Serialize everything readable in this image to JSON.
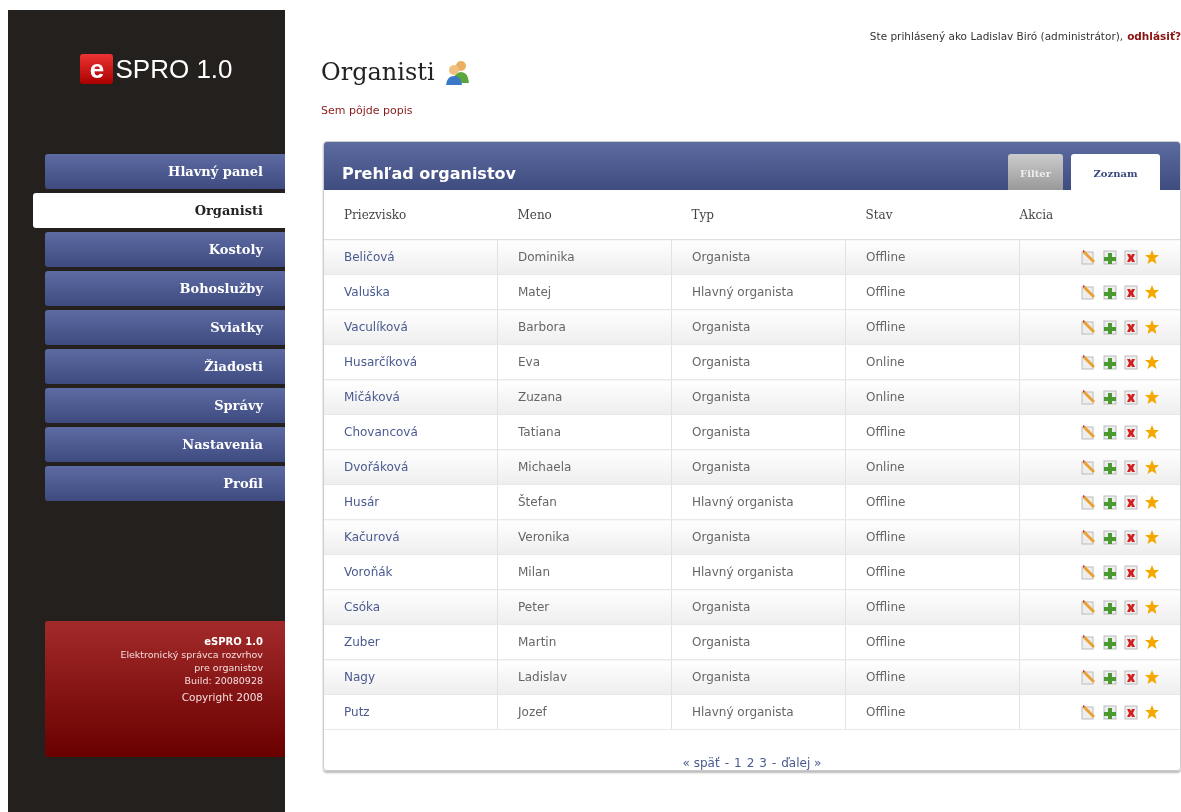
{
  "logo": {
    "mark": "e",
    "name": "SPRO 1.0"
  },
  "menu": [
    {
      "label": "Hlavný panel",
      "selected": false
    },
    {
      "label": "Organisti",
      "selected": true
    },
    {
      "label": "Kostoly",
      "selected": false
    },
    {
      "label": "Bohoslužby",
      "selected": false
    },
    {
      "label": "Sviatky",
      "selected": false
    },
    {
      "label": "Žiadosti",
      "selected": false
    },
    {
      "label": "Správy",
      "selected": false
    },
    {
      "label": "Nastavenia",
      "selected": false
    },
    {
      "label": "Profil",
      "selected": false
    }
  ],
  "footer": {
    "title": "eSPRO 1.0",
    "lines": [
      "Elektronický správca rozvrhov",
      "pre organistov",
      "Build: 20080928"
    ],
    "copyright": "Copyright 2008"
  },
  "user": {
    "text": "Ste prihlásený ako Ladislav Biró (administrátor),",
    "logout": "odhlásiť?"
  },
  "page": {
    "title": "Organisti",
    "description": "Sem pôjde popis"
  },
  "panel": {
    "title": "Prehľad organistov",
    "tabs": [
      {
        "label": "Filter",
        "selected": false
      },
      {
        "label": "Zoznam",
        "selected": true
      }
    ],
    "columns": [
      "Priezvisko",
      "Meno",
      "Typ",
      "Stav",
      "Akcia"
    ],
    "rows": [
      {
        "surname": "Beličová",
        "name": "Dominika",
        "type": "Organista",
        "status": "Offline"
      },
      {
        "surname": "Valuška",
        "name": "Matej",
        "type": "Hlavný organista",
        "status": "Offline"
      },
      {
        "surname": "Vaculíková",
        "name": "Barbora",
        "type": "Organista",
        "status": "Offline"
      },
      {
        "surname": "Husarčíková",
        "name": "Eva",
        "type": "Organista",
        "status": "Online"
      },
      {
        "surname": "Mičáková",
        "name": "Zuzana",
        "type": "Organista",
        "status": "Online"
      },
      {
        "surname": "Chovancová",
        "name": "Tatiana",
        "type": "Organista",
        "status": "Offline"
      },
      {
        "surname": "Dvořáková",
        "name": "Michaela",
        "type": "Organista",
        "status": "Online"
      },
      {
        "surname": "Husár",
        "name": "Štefan",
        "type": "Hlavný organista",
        "status": "Offline"
      },
      {
        "surname": "Kačurová",
        "name": "Veronika",
        "type": "Organista",
        "status": "Offline"
      },
      {
        "surname": "Voroňák",
        "name": "Milan",
        "type": "Hlavný organista",
        "status": "Offline"
      },
      {
        "surname": "Csóka",
        "name": "Peter",
        "type": "Organista",
        "status": "Offline"
      },
      {
        "surname": "Zuber",
        "name": "Martin",
        "type": "Organista",
        "status": "Offline"
      },
      {
        "surname": "Nagy",
        "name": "Ladislav",
        "type": "Organista",
        "status": "Offline"
      },
      {
        "surname": "Putz",
        "name": "Jozef",
        "type": "Hlavný organista",
        "status": "Offline"
      }
    ],
    "pagination": [
      "« späť",
      "-",
      "1",
      "2",
      "3",
      "-",
      "ďalej »"
    ]
  }
}
